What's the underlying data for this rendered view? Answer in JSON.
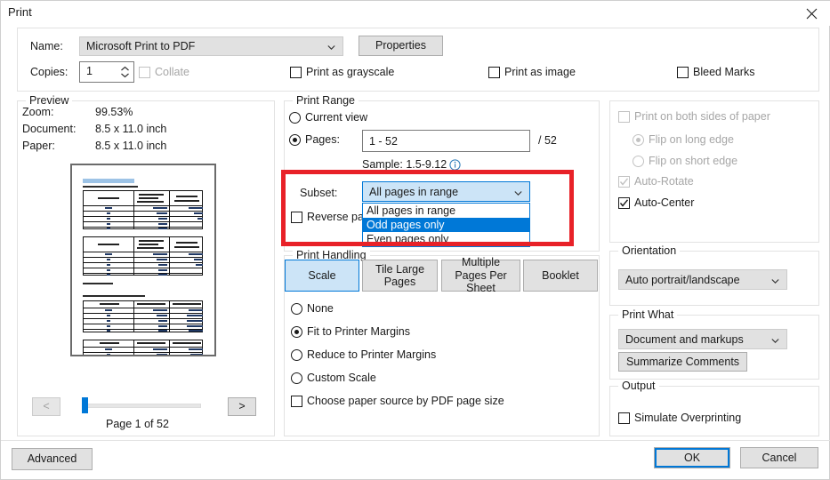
{
  "window": {
    "title": "Print",
    "close_icon": "close-icon"
  },
  "printer": {
    "name_label": "Name:",
    "name_value": "Microsoft Print to PDF",
    "properties_button": "Properties",
    "copies_label": "Copies:",
    "copies_value": "1",
    "collate_label": "Collate",
    "collate_checked": false,
    "collate_enabled": false,
    "print_as_grayscale_label": "Print as grayscale",
    "print_as_image_label": "Print as image",
    "bleed_marks_label": "Bleed Marks"
  },
  "preview": {
    "group_title": "Preview",
    "zoom_label": "Zoom:",
    "zoom_value": "99.53%",
    "document_label": "Document:",
    "document_value": "8.5 x 11.0 inch",
    "paper_label": "Paper:",
    "paper_value": "8.5 x 11.0 inch",
    "prev_button": "<",
    "next_button": ">",
    "page_status": "Page 1 of 52"
  },
  "print_range": {
    "group_title": "Print Range",
    "current_view_label": "Current view",
    "pages_label": "Pages:",
    "pages_value": "1 - 52",
    "total_pages": "/ 52",
    "sample_text": "Sample: 1.5-9.12",
    "info_icon": "info-icon",
    "subset_label": "Subset:",
    "subset_value": "All pages in range",
    "subset_options": [
      "All pages in range",
      "Odd pages only",
      "Even pages only"
    ],
    "subset_selected_index": 1,
    "reverse_pages_label": "Reverse pages"
  },
  "print_handling": {
    "group_title": "Print Handling",
    "tabs": [
      "Scale",
      "Tile Large Pages",
      "Multiple Pages Per Sheet",
      "Booklet"
    ],
    "active_tab_index": 0,
    "scale_options": [
      "None",
      "Fit to Printer Margins",
      "Reduce to Printer Margins",
      "Custom Scale"
    ],
    "scale_selected_index": 1,
    "paper_source_label": "Choose paper source by PDF page size"
  },
  "duplex": {
    "both_sides_label": "Print on both sides of paper",
    "flip_long_edge_label": "Flip on long edge",
    "flip_short_edge_label": "Flip on short edge",
    "auto_rotate_label": "Auto-Rotate",
    "auto_center_label": "Auto-Center"
  },
  "orientation": {
    "group_title": "Orientation",
    "value": "Auto portrait/landscape"
  },
  "print_what": {
    "group_title": "Print What",
    "value": "Document and markups",
    "summarize_button": "Summarize Comments"
  },
  "output": {
    "group_title": "Output",
    "simulate_overprinting_label": "Simulate Overprinting"
  },
  "footer": {
    "advanced_button": "Advanced",
    "ok_button": "OK",
    "cancel_button": "Cancel"
  },
  "colors": {
    "accent": "#0078d7",
    "annotation": "#e82128",
    "selected_item": "#0078d7",
    "hover_combo": "#cce4f7",
    "button_face": "#e1e1e1"
  }
}
